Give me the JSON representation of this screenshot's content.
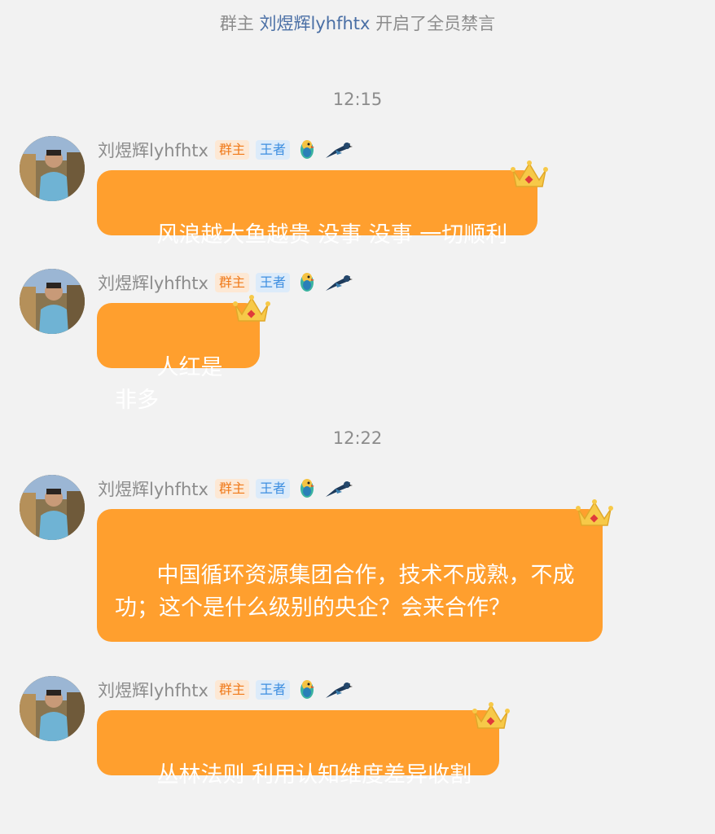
{
  "notice": {
    "prefix": "群主",
    "owner": "刘煜辉lyhfhtx",
    "suffix": "开启了全员禁言"
  },
  "timestamps": [
    "12:15",
    "12:22"
  ],
  "messages": [
    {
      "sender": "刘煜辉lyhfhtx",
      "badge_owner": "群主",
      "badge_king": "王者",
      "text": "风浪越大鱼越贵 没事 没事 一切顺利"
    },
    {
      "sender": "刘煜辉lyhfhtx",
      "badge_owner": "群主",
      "badge_king": "王者",
      "text": "人红是非多"
    },
    {
      "sender": "刘煜辉lyhfhtx",
      "badge_owner": "群主",
      "badge_king": "王者",
      "text": "中国循环资源集团合作，技术不成熟，不成功；这个是什么级别的央企？会来合作？"
    },
    {
      "sender": "刘煜辉lyhfhtx",
      "badge_owner": "群主",
      "badge_king": "王者",
      "text": "丛林法则 利用认知维度差异收割"
    }
  ],
  "colors": {
    "bubble": "#ff9f2e",
    "background": "#f2f2f2",
    "owner_badge": "#f07a1a",
    "king_badge": "#3d8ee0",
    "name_link": "#4a6fa5"
  },
  "icons": [
    "parrot-icon",
    "magpie-icon",
    "crown-icon"
  ]
}
